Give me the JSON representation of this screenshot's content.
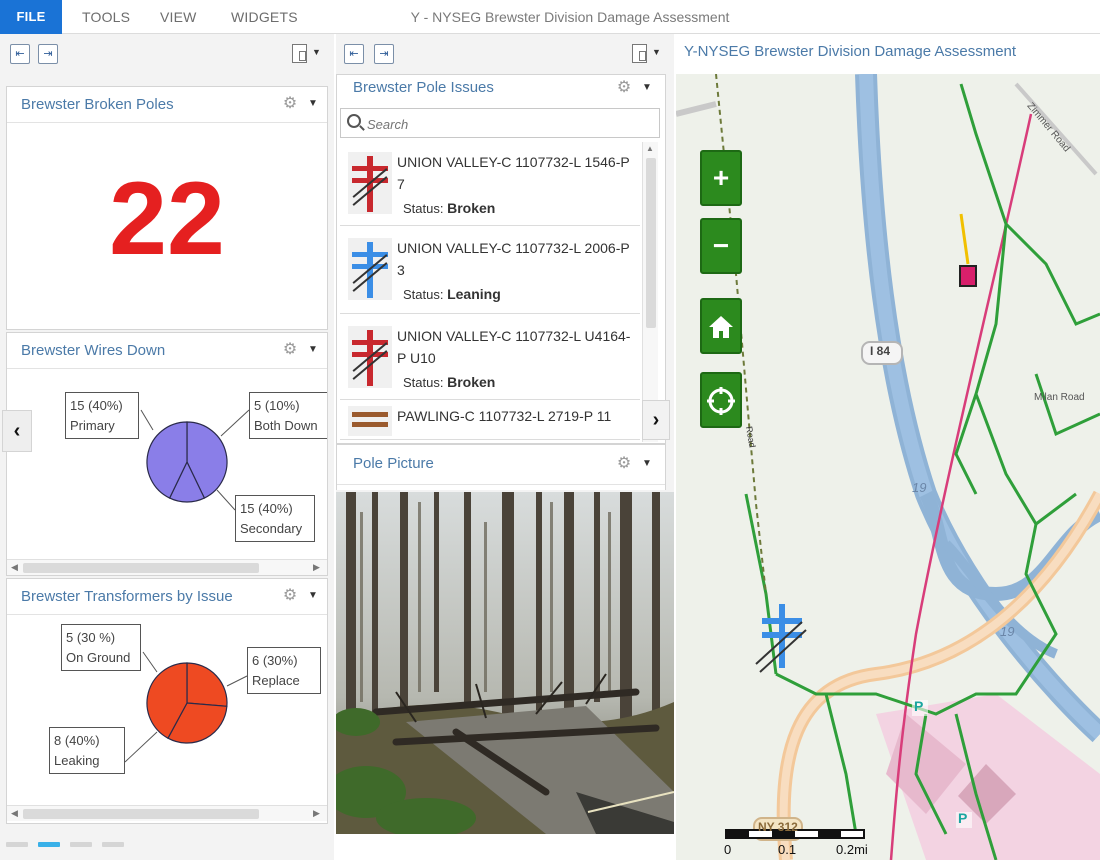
{
  "menu": {
    "file": "FILE",
    "tools": "TOOLS",
    "view": "VIEW",
    "widgets": "WIDGETS",
    "title": "Y - NYSEG Brewster Division Damage Assessment"
  },
  "broken_poles": {
    "title": "Brewster Broken Poles",
    "count": "22"
  },
  "wires_down": {
    "title": "Brewster Wires Down",
    "chart_data": {
      "type": "pie",
      "categories": [
        "Primary",
        "Both Down",
        "Secondary"
      ],
      "values": [
        15,
        5,
        15
      ],
      "labels": [
        {
          "value": "15 (40%)",
          "name": "Primary"
        },
        {
          "value": "5 (10%)",
          "name": "Both Down"
        },
        {
          "value": "15 (40%)",
          "name": "Secondary"
        }
      ],
      "colors": [
        "#8a7ee8"
      ]
    }
  },
  "transformers": {
    "title": "Brewster Transformers by Issue",
    "chart_data": {
      "type": "pie",
      "categories": [
        "On Ground",
        "Replace",
        "Leaking"
      ],
      "values": [
        5,
        6,
        8
      ],
      "labels": [
        {
          "value": "5 (30 %)",
          "name": "On Ground"
        },
        {
          "value": "6 (30%)",
          "name": "Replace"
        },
        {
          "value": "8 (40%)",
          "name": "Leaking"
        }
      ],
      "colors": [
        "#ee4a22"
      ]
    }
  },
  "pole_issues": {
    "title": "Brewster Pole Issues",
    "search_placeholder": "Search",
    "status_label": "Status:",
    "items": [
      {
        "title": "UNION VALLEY-C 1107732-L 1546-P 7",
        "status": "Broken",
        "color": "#c8282e"
      },
      {
        "title": "UNION VALLEY-C 1107732-L 2006-P 3",
        "status": "Leaning",
        "color": "#3b8ee6"
      },
      {
        "title": "UNION VALLEY-C 1107732-L U4164-P U10",
        "status": "Broken",
        "color": "#c8282e"
      },
      {
        "title": "PAWLING-C 1107732-L 2719-P 11",
        "status": "",
        "color": "#9a5a2e"
      }
    ]
  },
  "pole_picture": {
    "title": "Pole Picture"
  },
  "map": {
    "title": "Y-NYSEG Brewster Division Damage Assessment",
    "labels": {
      "road1": "Zimmer Road",
      "road2": "Milan Road",
      "i84": "I 84",
      "r19a": "19",
      "r19b": "19",
      "ny312": "NY 312",
      "parking1": "P",
      "parking2": "P",
      "brewster_rd": "Road"
    },
    "scale": {
      "ticks": [
        "0",
        "0.1",
        "0.2mi"
      ]
    },
    "buttons": {
      "zoom_in": "+",
      "zoom_out": "−"
    }
  },
  "colors": {
    "accent": "#1a73d6",
    "panel_title": "#4b7aa8",
    "big_number": "#e52020",
    "map_button": "#2c8a1e"
  }
}
